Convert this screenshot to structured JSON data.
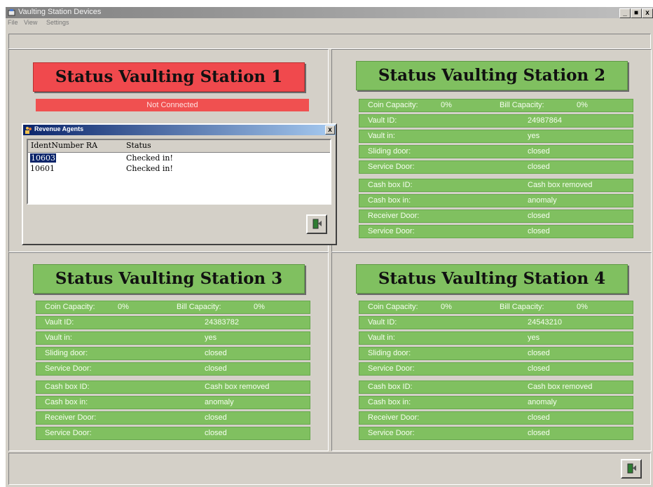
{
  "app": {
    "title": "Vaulting Station Devices"
  },
  "menu": [
    "File",
    "View",
    "Settings"
  ],
  "window_buttons": {
    "minimize": "_",
    "maximize": "■",
    "close": "x"
  },
  "stations": [
    {
      "title": "Status Vaulting Station 1",
      "status": "Not Connected"
    },
    {
      "title": "Status Vaulting Station 2",
      "coin_label": "Coin Capacity:",
      "coin_value": "0%",
      "bill_label": "Bill Capacity:",
      "bill_value": "0%",
      "vault": [
        {
          "label": "Vault ID:",
          "value": "24987864"
        },
        {
          "label": "Vault in:",
          "value": "yes"
        },
        {
          "label": "Sliding door:",
          "value": "closed"
        },
        {
          "label": "Service Door:",
          "value": "closed"
        }
      ],
      "cash": [
        {
          "label": "Cash box ID:",
          "value": "Cash box removed"
        },
        {
          "label": "Cash box in:",
          "value": "anomaly"
        },
        {
          "label": "Receiver Door:",
          "value": "closed"
        },
        {
          "label": "Service Door:",
          "value": "closed"
        }
      ]
    },
    {
      "title": "Status Vaulting Station 3",
      "coin_label": "Coin Capacity:",
      "coin_value": "0%",
      "bill_label": "Bill Capacity:",
      "bill_value": "0%",
      "vault": [
        {
          "label": "Vault ID:",
          "value": "24383782"
        },
        {
          "label": "Vault in:",
          "value": "yes"
        },
        {
          "label": "Sliding door:",
          "value": "closed"
        },
        {
          "label": "Service Door:",
          "value": "closed"
        }
      ],
      "cash": [
        {
          "label": "Cash box ID:",
          "value": "Cash box removed"
        },
        {
          "label": "Cash box in:",
          "value": "anomaly"
        },
        {
          "label": "Receiver Door:",
          "value": "closed"
        },
        {
          "label": "Service Door:",
          "value": "closed"
        }
      ]
    },
    {
      "title": "Status Vaulting Station 4",
      "coin_label": "Coin Capacity:",
      "coin_value": "0%",
      "bill_label": "Bill Capacity:",
      "bill_value": "0%",
      "vault": [
        {
          "label": "Vault ID:",
          "value": "24543210"
        },
        {
          "label": "Vault in:",
          "value": "yes"
        },
        {
          "label": "Sliding door:",
          "value": "closed"
        },
        {
          "label": "Service Door:",
          "value": "closed"
        }
      ],
      "cash": [
        {
          "label": "Cash box ID:",
          "value": "Cash box removed"
        },
        {
          "label": "Cash box in:",
          "value": "anomaly"
        },
        {
          "label": "Receiver Door:",
          "value": "closed"
        },
        {
          "label": "Service Door:",
          "value": "closed"
        }
      ]
    }
  ],
  "dialog": {
    "title": "Revenue Agents",
    "close": "x",
    "columns": [
      "IdentNumber RA",
      "Status"
    ],
    "rows": [
      {
        "id": "10603",
        "status": "Checked in!"
      },
      {
        "id": "10601",
        "status": "Checked in!"
      }
    ]
  },
  "icons": {
    "app": "vault-app-icon",
    "exit": "exit-door-icon"
  },
  "colors": {
    "green": "#80c060",
    "red": "#f0494d",
    "face": "#d4d0c8"
  }
}
